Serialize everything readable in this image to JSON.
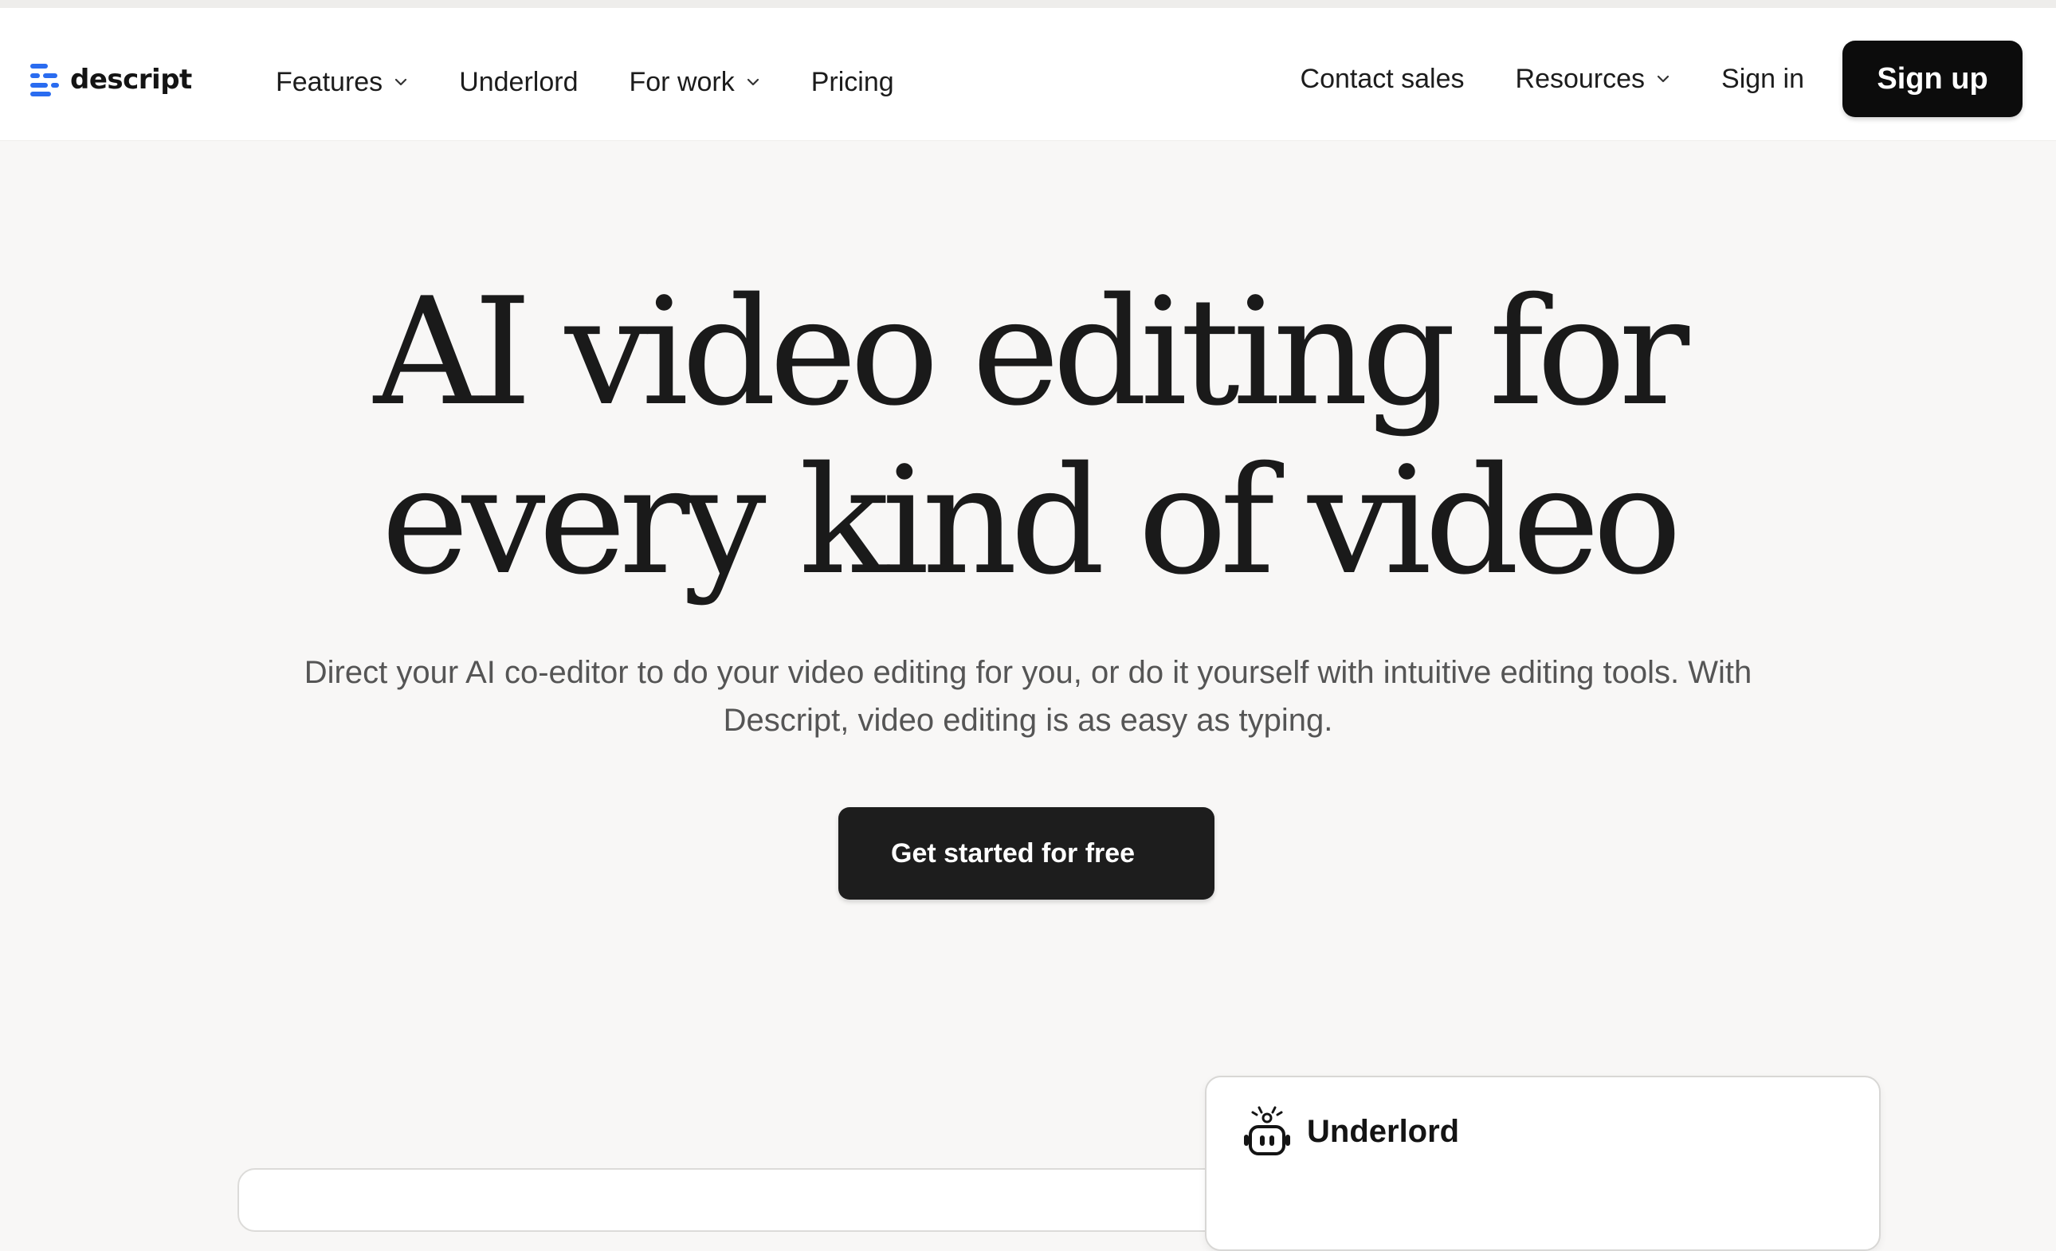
{
  "brand": {
    "name": "descript",
    "accent": "#2a6cf0"
  },
  "nav": {
    "left_items": [
      {
        "label": "Features",
        "has_dropdown": true
      },
      {
        "label": "Underlord",
        "has_dropdown": false
      },
      {
        "label": "For work",
        "has_dropdown": true
      },
      {
        "label": "Pricing",
        "has_dropdown": false
      }
    ],
    "right_items": [
      {
        "label": "Contact sales",
        "has_dropdown": false
      },
      {
        "label": "Resources",
        "has_dropdown": true
      },
      {
        "label": "Sign in",
        "has_dropdown": false
      }
    ],
    "signup_label": "Sign up",
    "dropdown_icon": "chevron-down-icon"
  },
  "hero": {
    "title_line1": "AI video editing for",
    "title_line2": "every kind of video",
    "subtitle": "Direct your AI co-editor to do your video editing for you, or do it yourself with intuitive editing tools. With Descript, video editing is as easy as typing.",
    "cta_label": "Get started for free"
  },
  "underlord_card": {
    "title": "Underlord",
    "icon": "robot-icon"
  },
  "colors": {
    "background": "#f8f7f6",
    "nav_background": "#ffffff",
    "button_dark": "#0c0c0c",
    "text_dark": "#1b1b1b",
    "text_muted": "#555555"
  }
}
